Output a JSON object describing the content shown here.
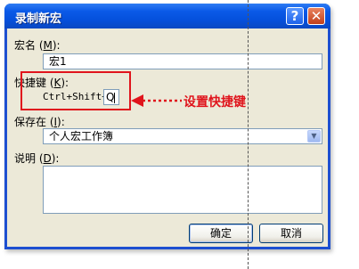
{
  "dialog": {
    "title": "录制新宏",
    "help_glyph": "?",
    "close_glyph": "✕"
  },
  "macro_name": {
    "label_prefix": "宏名 (",
    "label_key": "M",
    "label_suffix": "):",
    "value": "宏1"
  },
  "shortcut": {
    "label_prefix": "快捷键 (",
    "label_key": "K",
    "label_suffix": "):",
    "prefix_text": "Ctrl+Shift+",
    "key_value": "Q"
  },
  "store_in": {
    "label_prefix": "保存在 (",
    "label_key": "I",
    "label_suffix": "):",
    "selected": "个人宏工作簿"
  },
  "description": {
    "label_prefix": "说明 (",
    "label_key": "D",
    "label_suffix": "):",
    "value": ""
  },
  "buttons": {
    "ok": "确定",
    "cancel": "取消"
  },
  "annotation": {
    "text": "设置快捷键",
    "color": "#e0141c"
  },
  "colors": {
    "titlebar": "#0550dc",
    "dialog_bg": "#ece9d8"
  }
}
